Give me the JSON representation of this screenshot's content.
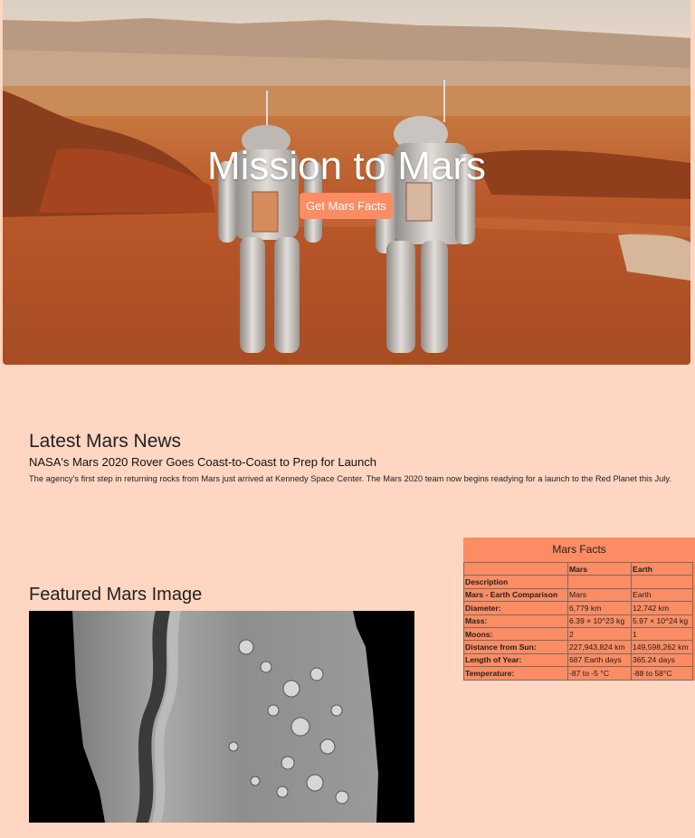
{
  "hero": {
    "title": "Mission to Mars",
    "button_label": "Get Mars Facts"
  },
  "news": {
    "heading": "Latest Mars News",
    "title": "NASA's Mars 2020 Rover Goes Coast-to-Coast to Prep for Launch",
    "paragraph": "The agency's first step in returning rocks from Mars just arrived at Kennedy Space Center. The Mars 2020 team now begins readying for a launch to the Red Planet this July."
  },
  "featured": {
    "heading": "Featured Mars Image"
  },
  "facts": {
    "caption": "Mars Facts",
    "headers": [
      "",
      "Mars",
      "Earth"
    ],
    "index_label": "Description",
    "rows": [
      {
        "label": "Mars - Earth Comparison",
        "mars": "Mars",
        "earth": "Earth"
      },
      {
        "label": "Diameter:",
        "mars": "6,779 km",
        "earth": "12,742 km"
      },
      {
        "label": "Mass:",
        "mars": "6.39 × 10^23 kg",
        "earth": "5.97 × 10^24 kg"
      },
      {
        "label": "Moons:",
        "mars": "2",
        "earth": "1"
      },
      {
        "label": "Distance from Sun:",
        "mars": "227,943,824 km",
        "earth": "149,598,262 km"
      },
      {
        "label": "Length of Year:",
        "mars": "687 Earth days",
        "earth": "365.24 days"
      },
      {
        "label": "Temperature:",
        "mars": "-87 to -5 °C",
        "earth": "-88 to 58°C"
      }
    ]
  },
  "colors": {
    "background": "#ffd6c2",
    "accent": "#fb8c63"
  }
}
